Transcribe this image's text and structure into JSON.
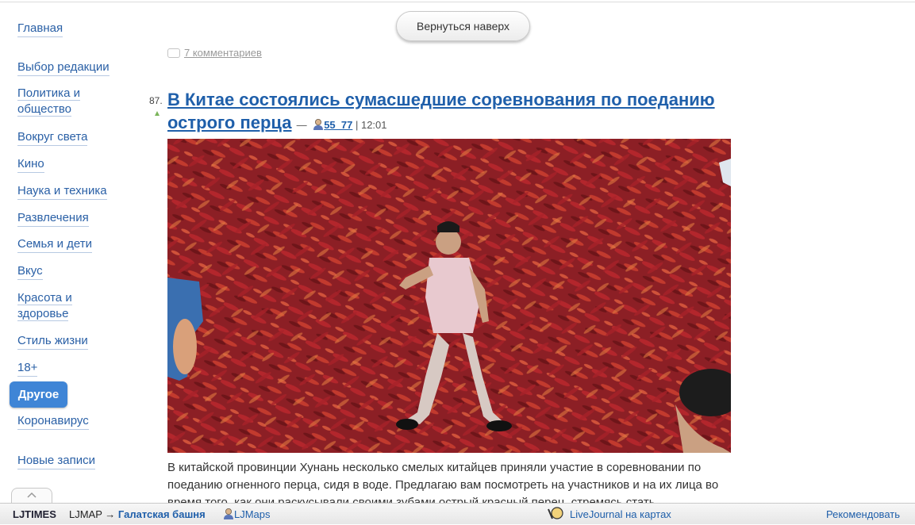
{
  "back_to_top": "Вернуться наверх",
  "sidebar": {
    "items": [
      {
        "label": "Главная"
      },
      {
        "label": "Выбор редакции"
      },
      {
        "label": "Политика и обществo",
        "line1": "Политика и",
        "line2": "общество"
      },
      {
        "label": "Вокруг света"
      },
      {
        "label": "Кино"
      },
      {
        "label": "Наука и техника"
      },
      {
        "label": "Развлечения"
      },
      {
        "label": "Семья и дети"
      },
      {
        "label": "Вкус"
      },
      {
        "label": "Красота и здоровье",
        "line1": "Красота и",
        "line2": "здоровье"
      },
      {
        "label": "Стиль жизни"
      },
      {
        "label": "18+"
      },
      {
        "label": "Другое",
        "active": true
      },
      {
        "label": "Коронавирус"
      },
      {
        "label": "Новые записи"
      }
    ],
    "up_tab_icon": "chevron-up-icon"
  },
  "comments": {
    "label": "7 комментариев"
  },
  "post": {
    "number": "87.",
    "title": "В Китае состоялись сумасшедшие соревнования по поеданию острого перца",
    "dash": "—",
    "author": "55_77",
    "time": "| 12:01",
    "body": "В китайской провинции Хунань несколько смелых китайцев приняли участие в соревновании по поеданию огненного перца, сидя в воде. Предлагаю вам посмотреть на участников и на их лица во время того, как они раскусывали своими зубами острый красный перец, стремясь стать"
  },
  "footer": {
    "logo": "LJTIMES",
    "ljmap": "LJMAP →",
    "place": "Галатская башня",
    "ljmaps": "LJMaps",
    "lj_on_maps": "LiveJournal на картах",
    "recommend": "Рекомендовать"
  },
  "colors": {
    "link": "#2a60a6",
    "title": "#1f5faa",
    "active_bg": "#3f85d6"
  }
}
